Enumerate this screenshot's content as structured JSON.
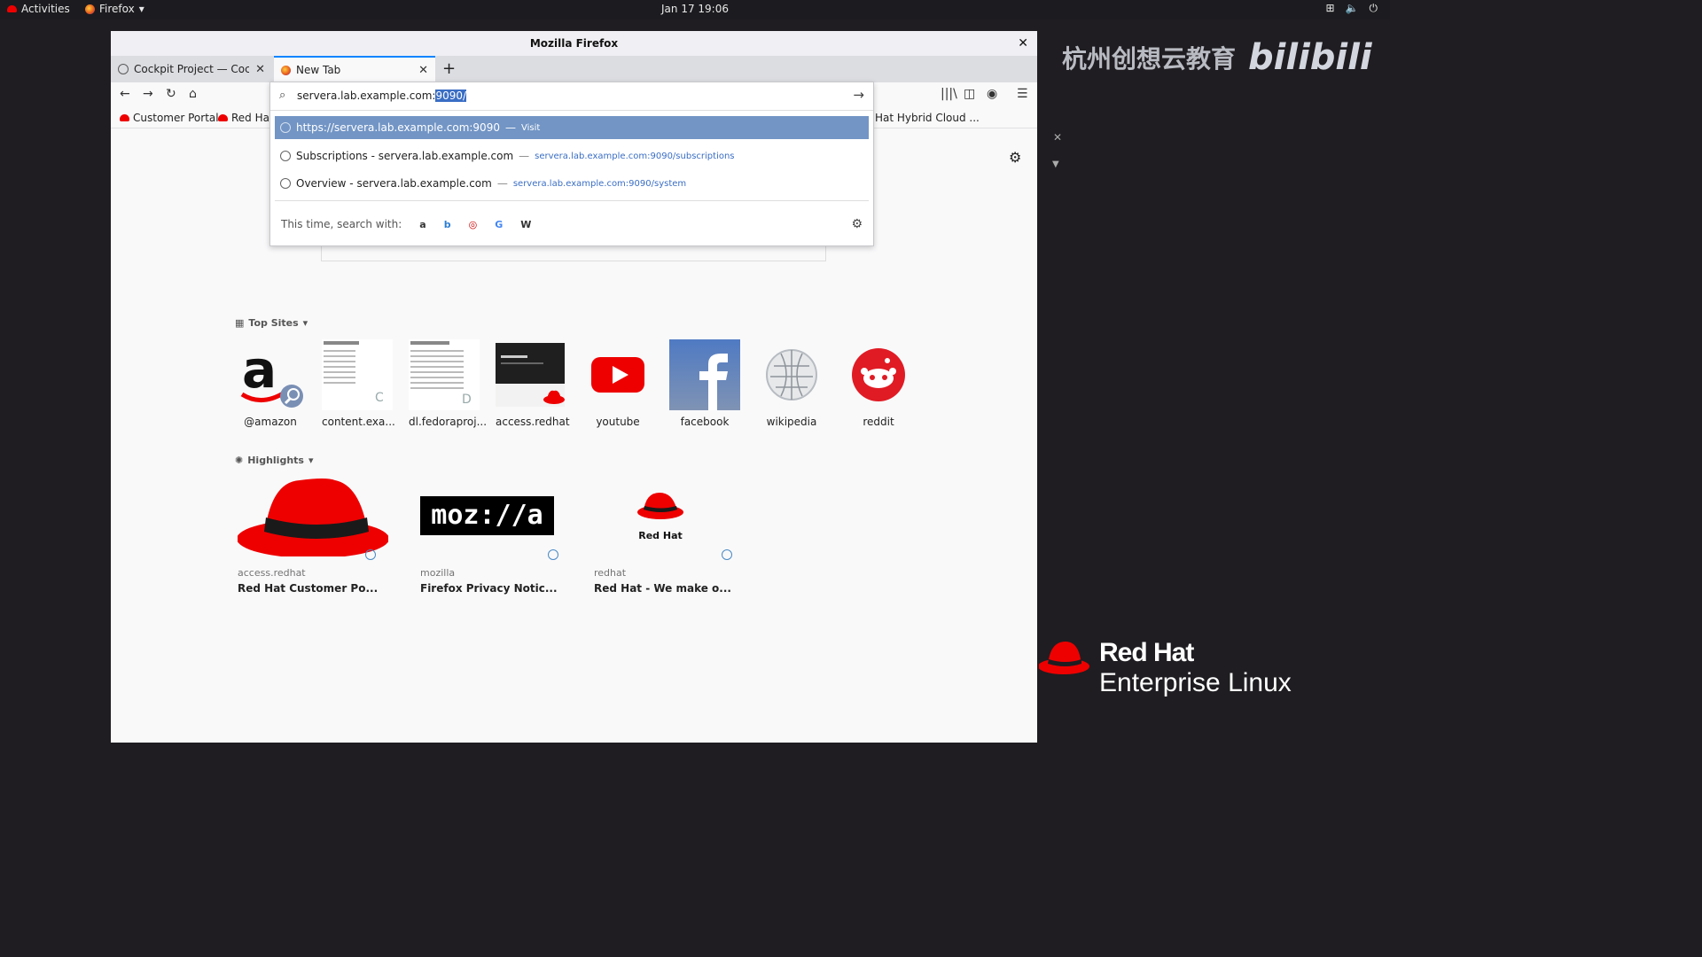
{
  "topbar": {
    "activities": "Activities",
    "app": "Firefox",
    "clock": "Jan 17  19:06"
  },
  "window": {
    "title": "Mozilla Firefox"
  },
  "tabs": [
    {
      "label": "Cockpit Project — Cockpit"
    },
    {
      "label": "New Tab"
    }
  ],
  "bookmarks": [
    {
      "label": "Customer Portal"
    },
    {
      "label": "Red Hat"
    },
    {
      "label": "Hat Hybrid Cloud ..."
    }
  ],
  "urlbar": {
    "typed": "server",
    "typed_rest": "a.lab.example.com:",
    "selected": "9090/",
    "suggestions": [
      {
        "main": "https://servera.lab.example.com:9090",
        "sep": "—",
        "sub": "Visit"
      },
      {
        "main": "Subscriptions - servera.lab.example.com",
        "sep": "—",
        "sub": "servera.lab.example.com:9090/subscriptions"
      },
      {
        "main": "Overview - servera.lab.example.com",
        "sep": "—",
        "sub": "servera.lab.example.com:9090/system"
      }
    ],
    "search_with": "This time, search with:",
    "engines": [
      "a",
      "b",
      "◎",
      "G",
      "W"
    ]
  },
  "top_sites": {
    "heading": "Top Sites",
    "items": [
      {
        "label": "@amazon"
      },
      {
        "label": "content.exa..."
      },
      {
        "label": "dl.fedoraproj..."
      },
      {
        "label": "access.redhat"
      },
      {
        "label": "youtube"
      },
      {
        "label": "facebook"
      },
      {
        "label": "wikipedia"
      },
      {
        "label": "reddit"
      }
    ]
  },
  "highlights": {
    "heading": "Highlights",
    "items": [
      {
        "domain": "access.redhat",
        "title": "Red Hat Customer Po..."
      },
      {
        "domain": "mozilla",
        "title": "Firefox Privacy Notic..."
      },
      {
        "domain": "redhat",
        "title": "Red Hat - We make o..."
      }
    ],
    "mozilla_logo": "moz://a",
    "redhat_logo": "Red Hat"
  },
  "overlay": {
    "watermark": "杭州创想云教育",
    "bilibili": "bilibili",
    "rhel_line1": "Red Hat",
    "rhel_line2": "Enterprise Linux"
  },
  "colors": {
    "accent": "#0a84ff",
    "highlight_row": "#7295c5",
    "redhat": "#ee0000"
  }
}
